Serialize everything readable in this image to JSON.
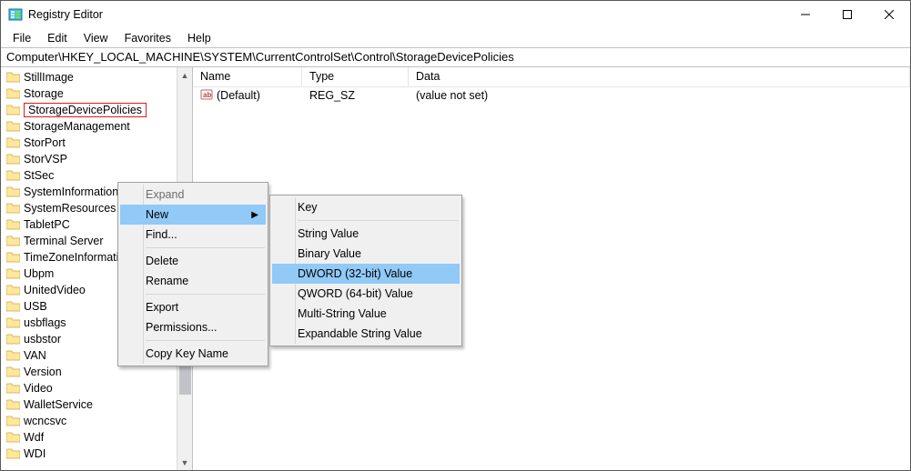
{
  "window": {
    "title": "Registry Editor"
  },
  "menubar": [
    "File",
    "Edit",
    "View",
    "Favorites",
    "Help"
  ],
  "address": "Computer\\HKEY_LOCAL_MACHINE\\SYSTEM\\CurrentControlSet\\Control\\StorageDevicePolicies",
  "tree": {
    "items": [
      "StillImage",
      "Storage",
      "StorageDevicePolicies",
      "StorageManagement",
      "StorPort",
      "StorVSP",
      "StSec",
      "SystemInformation",
      "SystemResources",
      "TabletPC",
      "Terminal Server",
      "TimeZoneInformation",
      "Ubpm",
      "UnitedVideo",
      "USB",
      "usbflags",
      "usbstor",
      "VAN",
      "Version",
      "Video",
      "WalletService",
      "wcncsvc",
      "Wdf",
      "WDI"
    ],
    "selectedIndex": 2
  },
  "list": {
    "columns": {
      "name": "Name",
      "type": "Type",
      "data": "Data"
    },
    "rows": [
      {
        "name": "(Default)",
        "type": "REG_SZ",
        "data": "(value not set)"
      }
    ]
  },
  "context_menu_1": {
    "items": [
      {
        "label": "Expand",
        "disabled": true
      },
      {
        "label": "New",
        "submenu": true,
        "highlight": true
      },
      {
        "label": "Find...",
        "disabled": false
      },
      {
        "sep": true
      },
      {
        "label": "Delete"
      },
      {
        "label": "Rename"
      },
      {
        "sep": true
      },
      {
        "label": "Export"
      },
      {
        "label": "Permissions..."
      },
      {
        "sep": true
      },
      {
        "label": "Copy Key Name"
      }
    ]
  },
  "context_menu_2": {
    "items": [
      {
        "label": "Key"
      },
      {
        "sep": true
      },
      {
        "label": "String Value"
      },
      {
        "label": "Binary Value"
      },
      {
        "label": "DWORD (32-bit) Value",
        "highlight": true
      },
      {
        "label": "QWORD (64-bit) Value"
      },
      {
        "label": "Multi-String Value"
      },
      {
        "label": "Expandable String Value"
      }
    ]
  }
}
